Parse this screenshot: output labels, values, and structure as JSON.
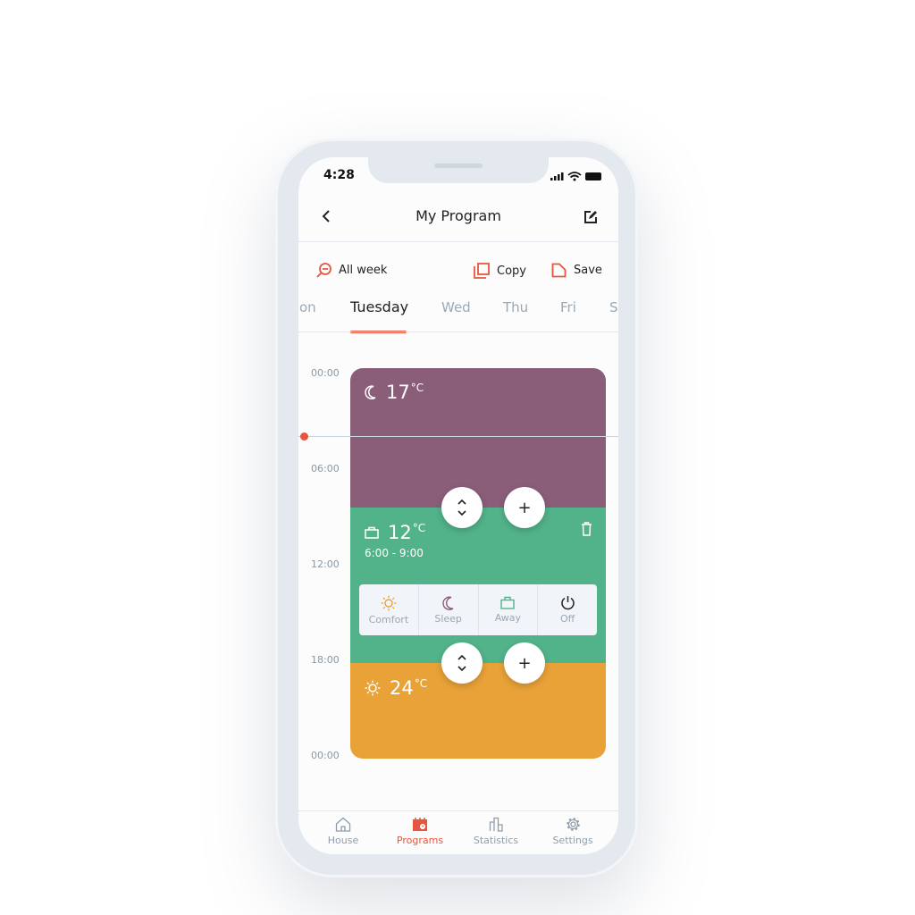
{
  "status_bar": {
    "time": "4:28"
  },
  "header": {
    "title": "My Program",
    "back_icon": "chevron-left-icon",
    "edit_icon": "edit-icon"
  },
  "toolbar": {
    "all_week": "All week",
    "copy": "Copy",
    "save": "Save"
  },
  "days": {
    "items": [
      "Mon",
      "Tuesday",
      "Wed",
      "Thu",
      "Fri",
      "Sat"
    ],
    "selected": "Tuesday"
  },
  "timeline": {
    "labels": [
      "00:00",
      "06:00",
      "12:00",
      "18:00",
      "00:00"
    ]
  },
  "segments": [
    {
      "mode": "Sleep",
      "temp": "17",
      "unit": "°C",
      "color": "#8a5d79",
      "icon": "moon-icon"
    },
    {
      "mode": "Away",
      "temp": "12",
      "unit": "°C",
      "range": "6:00 - 9:00",
      "color": "#52b38a",
      "icon": "briefcase-icon"
    },
    {
      "mode": "Comfort",
      "temp": "24",
      "unit": "°C",
      "color": "#e9a238",
      "icon": "sun-icon"
    }
  ],
  "mode_picker": [
    {
      "label": "Comfort",
      "icon": "sun-icon",
      "color": "#e9a238"
    },
    {
      "label": "Sleep",
      "icon": "moon-icon",
      "color": "#8a5d79"
    },
    {
      "label": "Away",
      "icon": "briefcase-icon",
      "color": "#52b38a"
    },
    {
      "label": "Off",
      "icon": "power-icon",
      "color": "#222222"
    }
  ],
  "bottom_nav": [
    {
      "label": "House",
      "icon": "house-icon"
    },
    {
      "label": "Programs",
      "icon": "calendar-icon",
      "active": true
    },
    {
      "label": "Statistics",
      "icon": "bar-chart-icon"
    },
    {
      "label": "Settings",
      "icon": "gear-icon"
    }
  ],
  "colors": {
    "accent": "#e8553e"
  }
}
